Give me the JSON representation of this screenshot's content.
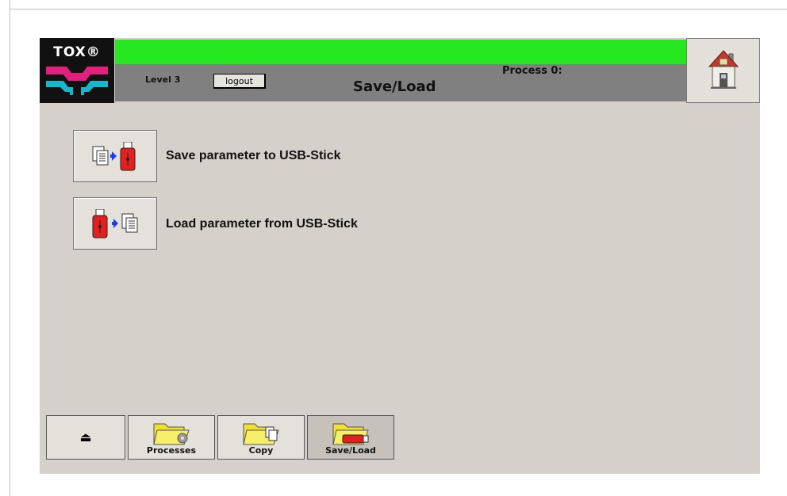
{
  "logo": {
    "text": "TOX®"
  },
  "header": {
    "level": "Level 3",
    "logout_label": "logout",
    "process_label": "Process 0:",
    "title": "Save/Load",
    "status_color": "#25e61f"
  },
  "actions": [
    {
      "label": "Save parameter to USB-Stick",
      "icon": "save-to-usb-icon"
    },
    {
      "label": "Load parameter from USB-Stick",
      "icon": "load-from-usb-icon"
    }
  ],
  "nav": [
    {
      "label": "",
      "icon": "eject-icon"
    },
    {
      "label": "Processes",
      "icon": "folder-gear-icon"
    },
    {
      "label": "Copy",
      "icon": "folder-copy-icon"
    },
    {
      "label": "Save/Load",
      "icon": "folder-usb-icon",
      "active": true
    }
  ]
}
